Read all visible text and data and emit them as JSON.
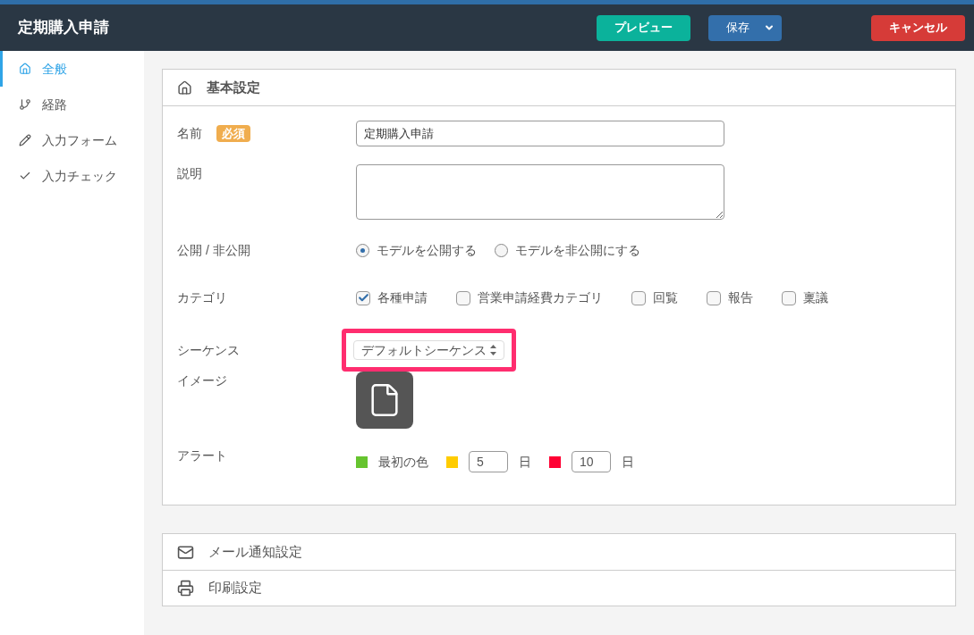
{
  "header": {
    "title": "定期購入申請",
    "preview_button": "プレビュー",
    "save_button": "保存",
    "cancel_button": "キャンセル"
  },
  "sidebar": {
    "items": [
      {
        "label": "全般",
        "kind": "home",
        "selected": true
      },
      {
        "label": "経路",
        "kind": "route",
        "selected": false
      },
      {
        "label": "入力フォーム",
        "kind": "pencil",
        "selected": false
      },
      {
        "label": "入力チェック",
        "kind": "check",
        "selected": false
      }
    ]
  },
  "basic_settings": {
    "title": "基本設定",
    "name": {
      "label": "名前",
      "badge": "必須",
      "value": "定期購入申請"
    },
    "description": {
      "label": "説明"
    },
    "visibility": {
      "label": "公開 / 非公開",
      "options": [
        {
          "label": "モデルを公開する",
          "selected": true
        },
        {
          "label": "モデルを非公開にする",
          "selected": false
        }
      ]
    },
    "category": {
      "label": "カテゴリ",
      "options": [
        {
          "label": "各種申請",
          "checked": true
        },
        {
          "label": "営業申請経費カテゴリ",
          "checked": false
        },
        {
          "label": "回覧",
          "checked": false
        },
        {
          "label": "報告",
          "checked": false
        },
        {
          "label": "稟議",
          "checked": false
        }
      ]
    },
    "sequence": {
      "label": "シーケンス",
      "value": "デフォルトシーケンス",
      "highlighted": true
    },
    "image": {
      "label": "イメージ"
    },
    "alert": {
      "label": "アラート",
      "items": [
        {
          "kind": "label",
          "color": "#66c42f",
          "label": "最初の色"
        },
        {
          "kind": "days",
          "color": "#ffcc00",
          "value": "5",
          "unit": "日"
        },
        {
          "kind": "days",
          "color": "#ff0033",
          "value": "10",
          "unit": "日"
        }
      ]
    }
  },
  "sections": [
    {
      "kind": "mail",
      "title": "メール通知設定"
    },
    {
      "kind": "print",
      "title": "印刷設定"
    }
  ]
}
